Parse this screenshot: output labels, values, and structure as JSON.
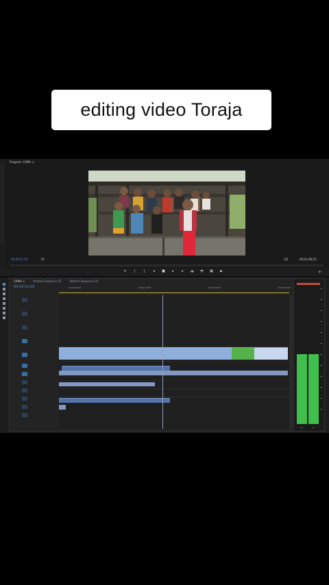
{
  "caption": "editing video Toraja",
  "program_monitor": {
    "tab_label": "Program: CAMA ≡",
    "timecode_left": "00;00;51;06",
    "fit_label": "Fit",
    "zoom_label": "1/2",
    "timecode_right": "00;01;48;23"
  },
  "timeline": {
    "tabs": [
      "CAMA ≡",
      "Nested Sequence 01",
      "Nested Sequence 02"
    ],
    "timecode": "00;00;51;06",
    "ruler_ticks": [
      "00;00;00;00",
      "00;00;32;00",
      "00;01;04;02",
      "00;01;36;02"
    ]
  },
  "colors": {
    "video_clip": "#8fb0dd",
    "video_clip_green": "#55b24a",
    "audio_clip": "#5272a8",
    "meter_green": "#3fbf4c",
    "meter_peak": "#c94a3c",
    "timecode_blue": "#4f8bd6"
  },
  "icons": {
    "transport": [
      "mark-in-icon",
      "mark-out-icon",
      "go-to-in-icon",
      "step-back-icon",
      "stop-icon",
      "step-forward-icon",
      "go-to-out-icon",
      "insert-icon",
      "overwrite-icon",
      "export-frame-icon",
      "settings-icon"
    ],
    "tools": [
      "selection-tool-icon",
      "track-select-icon",
      "ripple-edit-icon",
      "razor-tool-icon",
      "slip-tool-icon",
      "pen-tool-icon",
      "hand-tool-icon",
      "type-tool-icon"
    ]
  },
  "audio_meter": {
    "levels": [
      0.51,
      0.51
    ],
    "channels": [
      "S",
      "S"
    ]
  }
}
